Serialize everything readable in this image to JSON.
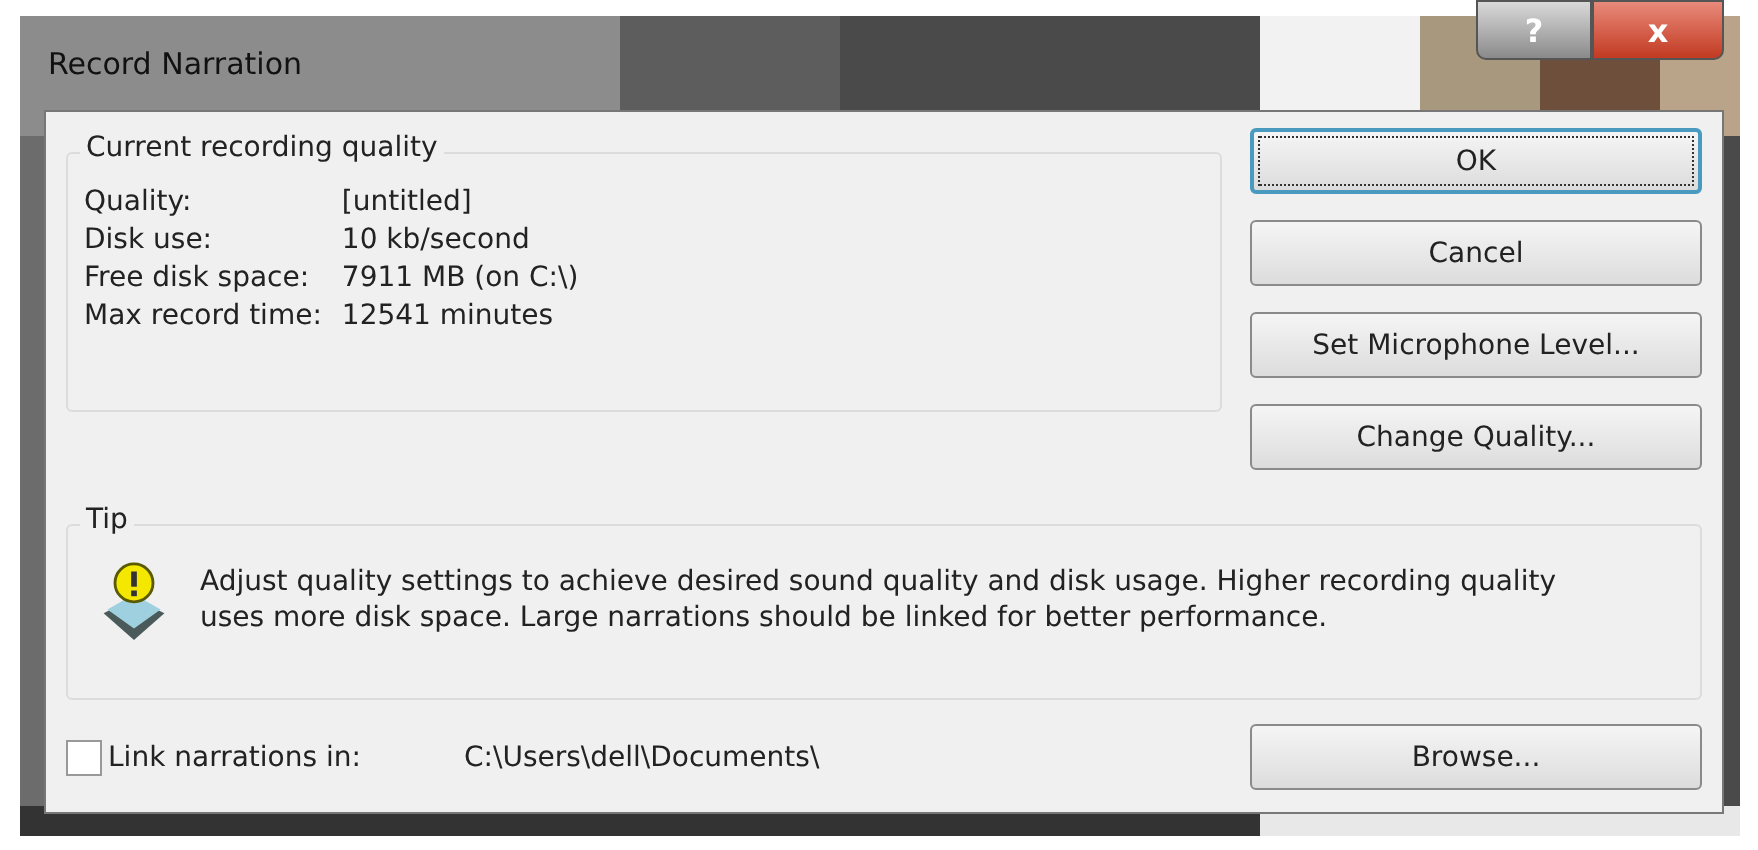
{
  "window": {
    "title": "Record Narration",
    "help_button": "?",
    "close_button": "x"
  },
  "quality_group": {
    "title": "Current recording quality",
    "rows": [
      {
        "label": "Quality:",
        "value": "[untitled]"
      },
      {
        "label": "Disk use:",
        "value": "10 kb/second"
      },
      {
        "label": "Free disk space:",
        "value": "7911 MB (on C:\\)"
      },
      {
        "label": "Max record time:",
        "value": "12541 minutes"
      }
    ]
  },
  "buttons": [
    {
      "label": "OK",
      "default": true
    },
    {
      "label": "Cancel",
      "default": false
    },
    {
      "label": "Set Microphone Level...",
      "default": false
    },
    {
      "label": "Change Quality...",
      "default": false
    }
  ],
  "tip": {
    "title": "Tip",
    "text": "Adjust quality settings to achieve desired sound quality and disk usage. Higher recording quality uses more disk space. Large narrations should be linked for better performance."
  },
  "link": {
    "label": "Link narrations in:",
    "checked": false,
    "path": "C:\\Users\\dell\\Documents\\",
    "button": "Browse..."
  }
}
